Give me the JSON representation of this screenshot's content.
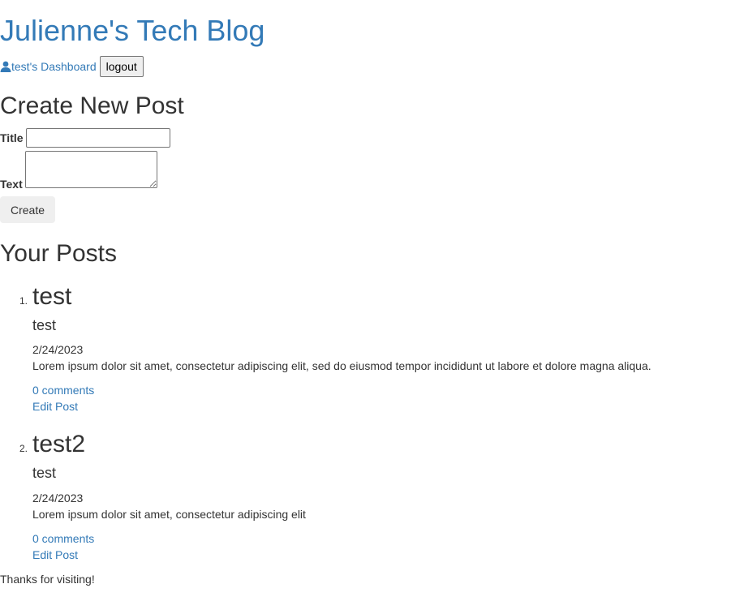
{
  "header": {
    "site_title": "Julienne's Tech Blog",
    "dashboard_link": "test's Dashboard",
    "logout_label": "logout"
  },
  "create_form": {
    "heading": "Create New Post",
    "title_label": "Title",
    "title_value": "",
    "text_label": "Text",
    "text_value": "",
    "create_label": "Create"
  },
  "posts_section": {
    "heading": "Your Posts",
    "posts": [
      {
        "number": "1.",
        "title": "test",
        "subtitle": "test",
        "date": "2/24/2023",
        "body": "Lorem ipsum dolor sit amet, consectetur adipiscing elit, sed do eiusmod tempor incididunt ut labore et dolore magna aliqua.",
        "comments": "0 comments",
        "edit": "Edit Post"
      },
      {
        "number": "2.",
        "title": "test2",
        "subtitle": "test",
        "date": "2/24/2023",
        "body": "Lorem ipsum dolor sit amet, consectetur adipiscing elit",
        "comments": "0 comments",
        "edit": "Edit Post"
      }
    ]
  },
  "footer": {
    "text": "Thanks for visiting!"
  },
  "icons": {
    "dashboard": "user-icon"
  },
  "colors": {
    "link": "#337ab7",
    "text": "#333333",
    "button_bg": "#efefef"
  }
}
